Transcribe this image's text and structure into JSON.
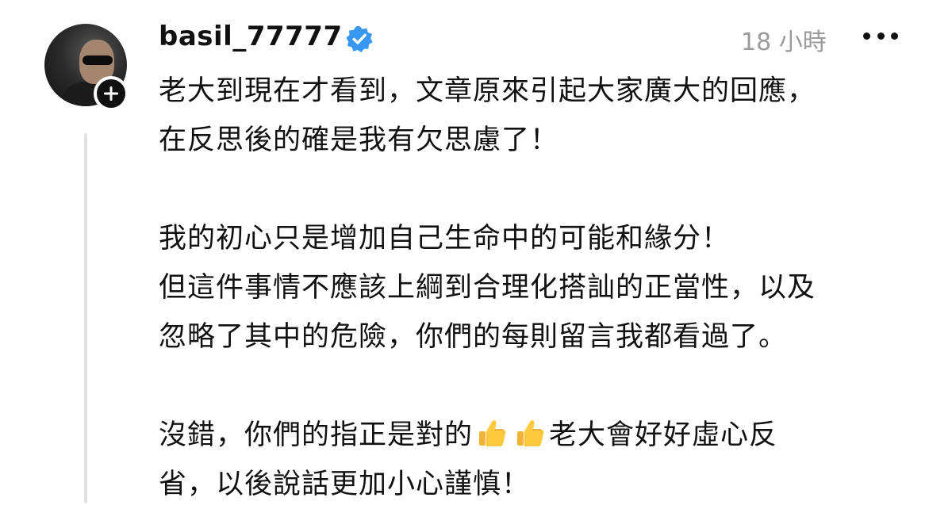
{
  "post": {
    "username": "basil_77777",
    "time": "18 小時",
    "paragraphs": [
      [
        "老大到現在才看到，文章原來引起大家廣大的回應，",
        "在反思後的確是我有欠思慮了！"
      ],
      [
        "我的初心只是增加自己生命中的可能和緣分！",
        "但這件事情不應該上綱到合理化搭訕的正當性，以及",
        "忽略了其中的危險，你們的每則留言我都看過了。"
      ],
      [
        "沒錯，你們的指正是對的",
        "老大會好好虛心反",
        "省，以後說話更加小心謹慎！"
      ]
    ]
  },
  "colors": {
    "verified": "#3897f0",
    "text": "#111111",
    "muted": "#9a9a9a",
    "thread_line": "#e2e2e2"
  },
  "icons": {
    "verified": "verified-badge-icon",
    "more": "more-icon",
    "follow": "plus-icon",
    "emoji": "thumbs-up-icon"
  }
}
